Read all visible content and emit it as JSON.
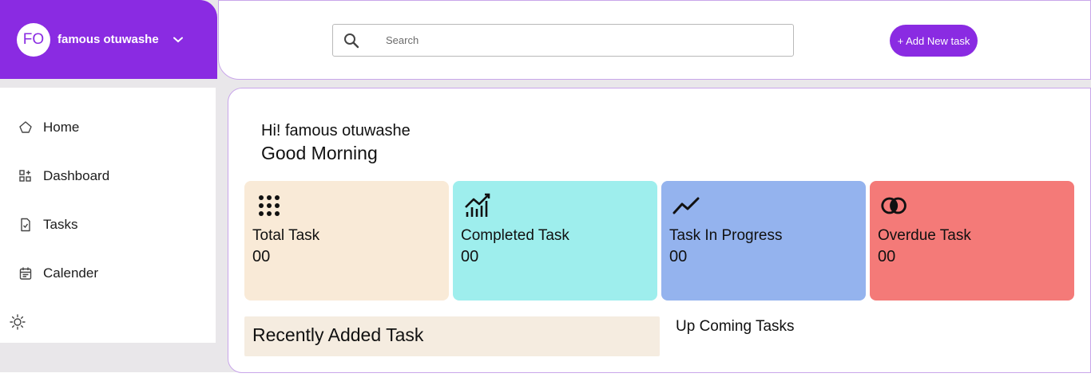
{
  "user": {
    "initials": "FO",
    "name": "famous otuwashe"
  },
  "search": {
    "placeholder": "Search",
    "value": ""
  },
  "header": {
    "add_button_label": "+ Add New task"
  },
  "sidebar": {
    "items": [
      {
        "label": "Home",
        "icon": "home-icon"
      },
      {
        "label": "Dashboard",
        "icon": "dashboard-icon"
      },
      {
        "label": "Tasks",
        "icon": "tasks-icon"
      },
      {
        "label": "Calender",
        "icon": "calendar-icon"
      }
    ],
    "theme_toggle_icon": "sun-icon"
  },
  "greeting": {
    "hello": "Hi! famous otuwashe",
    "time_of_day": "Good Morning"
  },
  "stats": [
    {
      "label": "Total Task",
      "count": "00",
      "color": "#f9ead7",
      "icon": "dots-grid-icon"
    },
    {
      "label": "Completed Task",
      "count": "00",
      "color": "#9eeeed",
      "icon": "bar-chart-icon"
    },
    {
      "label": "Task In Progress",
      "count": "00",
      "color": "#94b3ee",
      "icon": "trend-line-icon"
    },
    {
      "label": "Overdue Task",
      "count": "00",
      "color": "#f47a78",
      "icon": "overlap-circles-icon"
    }
  ],
  "sections": {
    "recent_title": "Recently Added Task",
    "upcoming_title": "Up Coming Tasks"
  },
  "colors": {
    "accent": "#8a2be2",
    "recent_bg": "#f5ece0"
  }
}
